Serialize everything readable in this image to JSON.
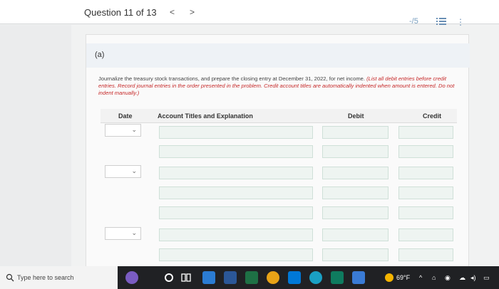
{
  "header": {
    "question_title": "Question 11 of 13",
    "prev_glyph": "<",
    "next_glyph": ">",
    "score": "-/5"
  },
  "part": {
    "label": "(a)"
  },
  "instructions": {
    "main": "Journalize the treasury stock transactions, and prepare the closing entry at December 31, 2022, for net income. ",
    "emphasis": "(List all debit entries before credit entries. Record journal entries in the order presented in the problem. Credit account titles are automatically indented when amount is entered. Do not indent manually.)"
  },
  "table": {
    "headers": {
      "date": "Date",
      "account": "Account Titles and Explanation",
      "debit": "Debit",
      "credit": "Credit"
    }
  },
  "taskbar": {
    "search_placeholder": "Type here to search",
    "weather": "69°F"
  },
  "colors": {
    "accent": "#6a8fb5",
    "instruction_emphasis": "#c62828",
    "taskbar_bg": "#202124"
  }
}
